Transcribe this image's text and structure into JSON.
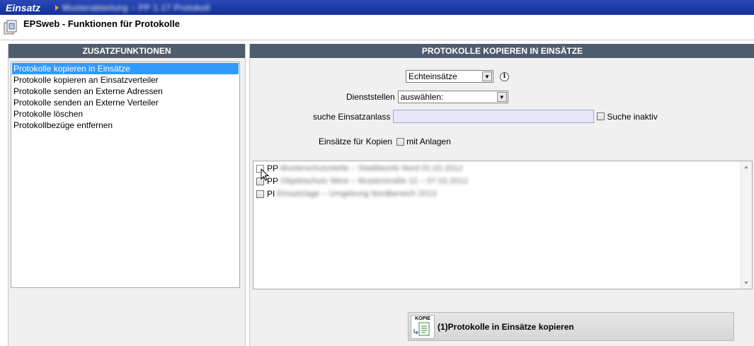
{
  "topbar": {
    "app": "Einsatz",
    "breadcrumb": "Musterabteilung – PP 1.17 Protokoll"
  },
  "page": {
    "title": "EPSweb - Funktionen für Protokolle"
  },
  "left": {
    "header": "ZUSATZFUNKTIONEN",
    "items": [
      "Protokolle kopieren in Einsätze",
      "Protokolle kopieren an Einsatzverteiler",
      "Protokolle senden an Externe Adressen",
      "Protokolle senden an Externe Verteiler",
      "Protokolle löschen",
      "Protokollbezüge entfernen"
    ],
    "selected_index": 0
  },
  "right": {
    "header": "PROTOKOLLE KOPIEREN IN EINSÄTZE",
    "einsatz_type": "Echteinsätze",
    "dienststellen_label": "Dienststellen",
    "dienststellen_value": "auswählen:",
    "suche_label": "suche Einsatzanlass",
    "suche_value": "",
    "suche_inaktiv_label": "Suche inaktiv",
    "kopien_label": "Einsätze für Kopien",
    "mit_anlagen_label": "mit Anlagen",
    "einsaetze": [
      {
        "code": "PP",
        "text": "Musterschutzstelle – Stadtbezirk Nord 01.02.2012"
      },
      {
        "code": "PP",
        "text": "Objektschutz West – Musterstraße 12 – 07.02.2012"
      },
      {
        "code": "PI",
        "text": "Einsatzlage – Umgebung Nordbereich 2013"
      }
    ],
    "copy_icon_label": "KOPIE",
    "copy_button_label": "(1)Protokolle in Einsätze kopieren"
  }
}
